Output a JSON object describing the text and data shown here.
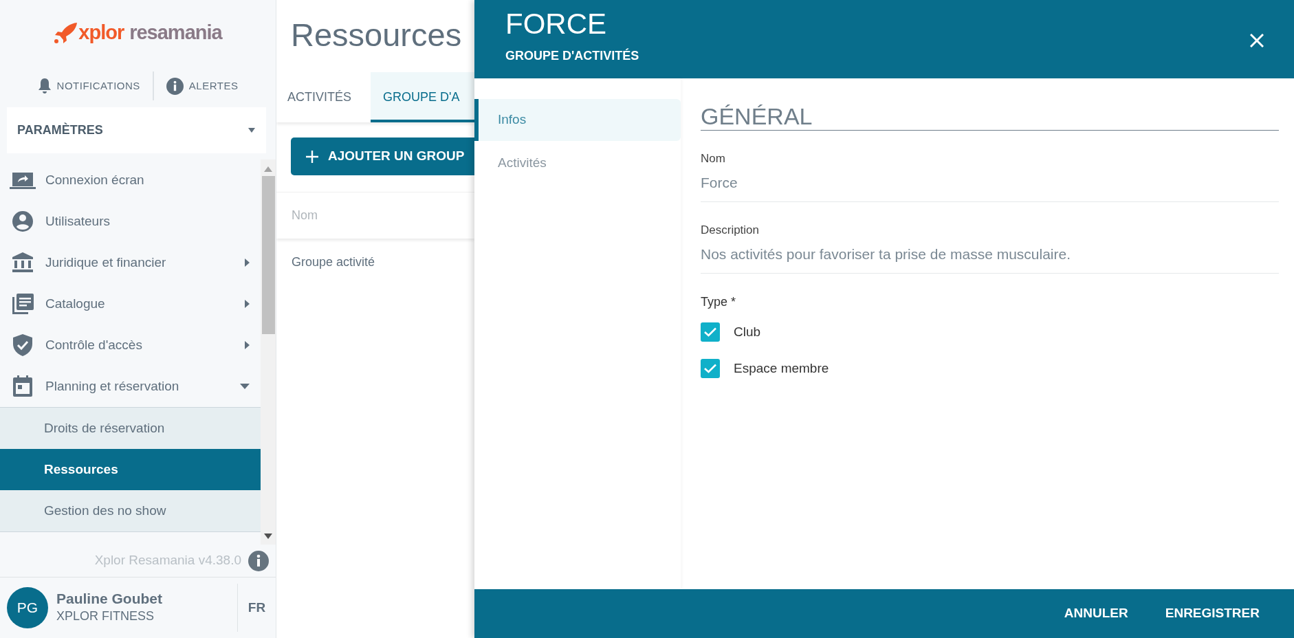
{
  "logo": {
    "brand": "xplor",
    "product": "resamania"
  },
  "top_actions": [
    {
      "label": "NOTIFICATIONS"
    },
    {
      "label": "ALERTES"
    }
  ],
  "section_select": {
    "label": "PARAMÈTRES"
  },
  "menu": [
    {
      "label": "Connexion écran",
      "selected": false
    },
    {
      "label": "Utilisateurs",
      "selected": false
    },
    {
      "label": "Juridique et financier",
      "selected": false,
      "expanded": false
    },
    {
      "label": "Catalogue",
      "selected": false,
      "expanded": false
    },
    {
      "label": "Contrôle d'accès",
      "selected": false,
      "expanded": false
    },
    {
      "label": "Planning et réservation",
      "selected": false,
      "expanded": true,
      "children": [
        {
          "label": "Droits de réservation",
          "selected": false
        },
        {
          "label": "Ressources",
          "selected": true
        },
        {
          "label": "Gestion des no show",
          "selected": false
        }
      ]
    }
  ],
  "version": "Xplor Resamania v4.38.0",
  "user": {
    "initials": "PG",
    "name": "Pauline Goubet",
    "company": "XPLOR FITNESS",
    "language": "FR"
  },
  "main": {
    "title": "Ressources",
    "tabs": [
      {
        "label": "ACTIVITÉS",
        "selected": false
      },
      {
        "label": "GROUPE D'A",
        "selected": true
      }
    ],
    "add_button": "AJOUTER UN GROUP",
    "table": {
      "columns": [
        "Nom"
      ],
      "rows": [
        [
          "Groupe activité"
        ]
      ]
    }
  },
  "panel": {
    "title": "FORCE",
    "subtitle": "GROUPE D'ACTIVITÉS",
    "nav": [
      {
        "label": "Infos",
        "selected": true
      },
      {
        "label": "Activités",
        "selected": false
      }
    ],
    "section_title": "GÉNÉRAL",
    "fields": [
      {
        "label": "Nom",
        "value": "Force"
      },
      {
        "label": "Description",
        "value": "Nos activités pour favoriser ta prise de masse musculaire."
      }
    ],
    "type_group": {
      "label": "Type *",
      "options": [
        {
          "label": "Club",
          "checked": true
        },
        {
          "label": "Espace membre",
          "checked": true
        }
      ]
    },
    "footer_buttons": [
      "ANNULER",
      "ENREGISTRER"
    ]
  }
}
